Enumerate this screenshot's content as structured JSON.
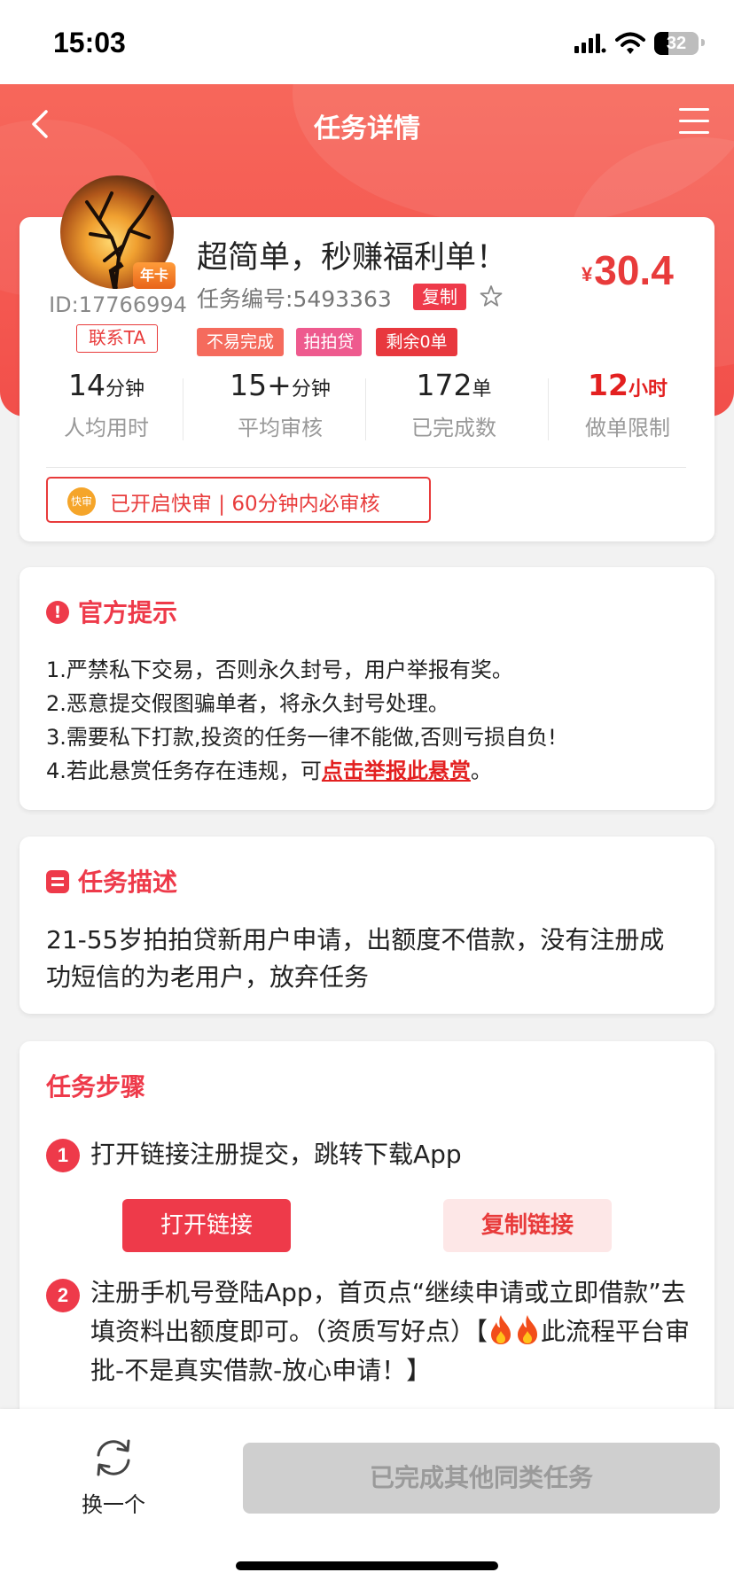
{
  "status_bar": {
    "time": "15:03",
    "battery": "32"
  },
  "nav": {
    "title": "任务详情"
  },
  "task": {
    "avatar_badge": "年卡",
    "user_id": "ID:17766994",
    "contact": "联系TA",
    "title": "超简单，秒赚福利单！",
    "price_symbol": "¥",
    "price": "30.4",
    "task_no": "任务编号:5493363",
    "copy": "复制",
    "tags": [
      "不易完成",
      "拍拍贷",
      "剩余0单"
    ]
  },
  "stats": [
    {
      "value": "14",
      "unit": "分钟",
      "label": "人均用时"
    },
    {
      "value": "15+",
      "unit": "分钟",
      "label": "平均审核"
    },
    {
      "value": "172",
      "unit": "单",
      "label": "已完成数"
    },
    {
      "value": "12",
      "unit": "小时",
      "label": "做单限制"
    }
  ],
  "fast_review": {
    "icon_label": "快审",
    "text": "已开启快审 | 60分钟内必审核"
  },
  "notice": {
    "title": "官方提示",
    "icon": "!",
    "lines": [
      "1.严禁私下交易，否则永久封号，用户举报有奖。",
      "2.恶意提交假图骗单者，将永久封号处理。",
      "3.需要私下打款,投资的任务一律不能做,否则亏损自负!"
    ],
    "line4_prefix": "4.若此悬赏任务存在违规，可",
    "line4_link": "点击举报此悬赏",
    "line4_suffix": "。"
  },
  "description": {
    "title": "任务描述",
    "text": "21-55岁拍拍贷新用户申请，出额度不借款，没有注册成功短信的为老用户，放弃任务"
  },
  "steps": {
    "title": "任务步骤",
    "items": [
      {
        "num": "1",
        "text": "打开链接注册提交，跳转下载App"
      },
      {
        "num": "2",
        "text_a": "注册手机号登陆App，首页点“继续申请或立即借款”去填资料出额度即可。（资质写好点）【",
        "text_b": "此流程平台审批-不是真实借款-放心申请！】"
      }
    ],
    "open_link": "打开链接",
    "copy_link": "复制链接"
  },
  "bottom": {
    "refresh": "换一个",
    "done": "已完成其他同类任务"
  },
  "colors": {
    "accent": "#ee3a4a",
    "header": "#f24f4a",
    "price": "#e83b3b"
  },
  "icons": [
    "back-arrow-icon",
    "menu-icon",
    "star-icon",
    "alert-icon",
    "document-icon",
    "fire-icon",
    "refresh-icon"
  ]
}
